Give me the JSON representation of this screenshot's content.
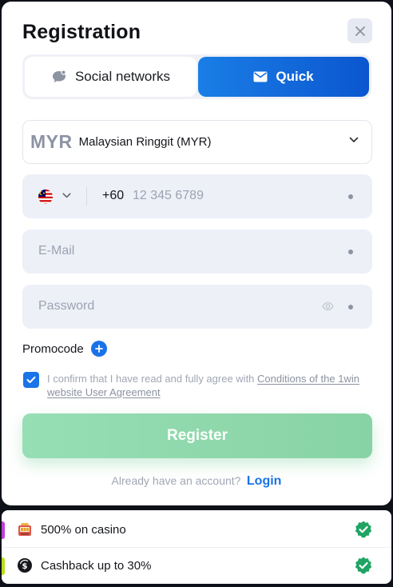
{
  "modal": {
    "title": "Registration",
    "close_icon": "close-icon"
  },
  "tabs": [
    {
      "label": "Social networks",
      "icon": "chat-bubble-icon",
      "active": false
    },
    {
      "label": "Quick",
      "icon": "envelope-icon",
      "active": true
    }
  ],
  "currency": {
    "code": "MYR",
    "name": "Malaysian Ringgit (MYR)"
  },
  "phone": {
    "country_flag": "malaysia-flag-icon",
    "dial_code": "+60",
    "placeholder": "12 345 6789"
  },
  "email": {
    "placeholder": "E-Mail"
  },
  "password": {
    "placeholder": "Password"
  },
  "promocode": {
    "label": "Promocode"
  },
  "agreement": {
    "checked": true,
    "text": "I confirm that I have read and fully agree with ",
    "link": "Conditions of the 1win website User Agreement"
  },
  "register": {
    "label": "Register"
  },
  "login": {
    "question": "Already have an account?",
    "link": "Login"
  },
  "bonuses": [
    {
      "label": "500% on casino",
      "icon": "slot-machine-icon",
      "accent": "#c03ed9"
    },
    {
      "label": "Cashback up to 30%",
      "icon": "cashback-icon",
      "accent": "#b6e019"
    }
  ],
  "colors": {
    "accent_blue": "#1a73e8",
    "register_green": "#8fd9ad",
    "check_green": "#1fa463"
  }
}
